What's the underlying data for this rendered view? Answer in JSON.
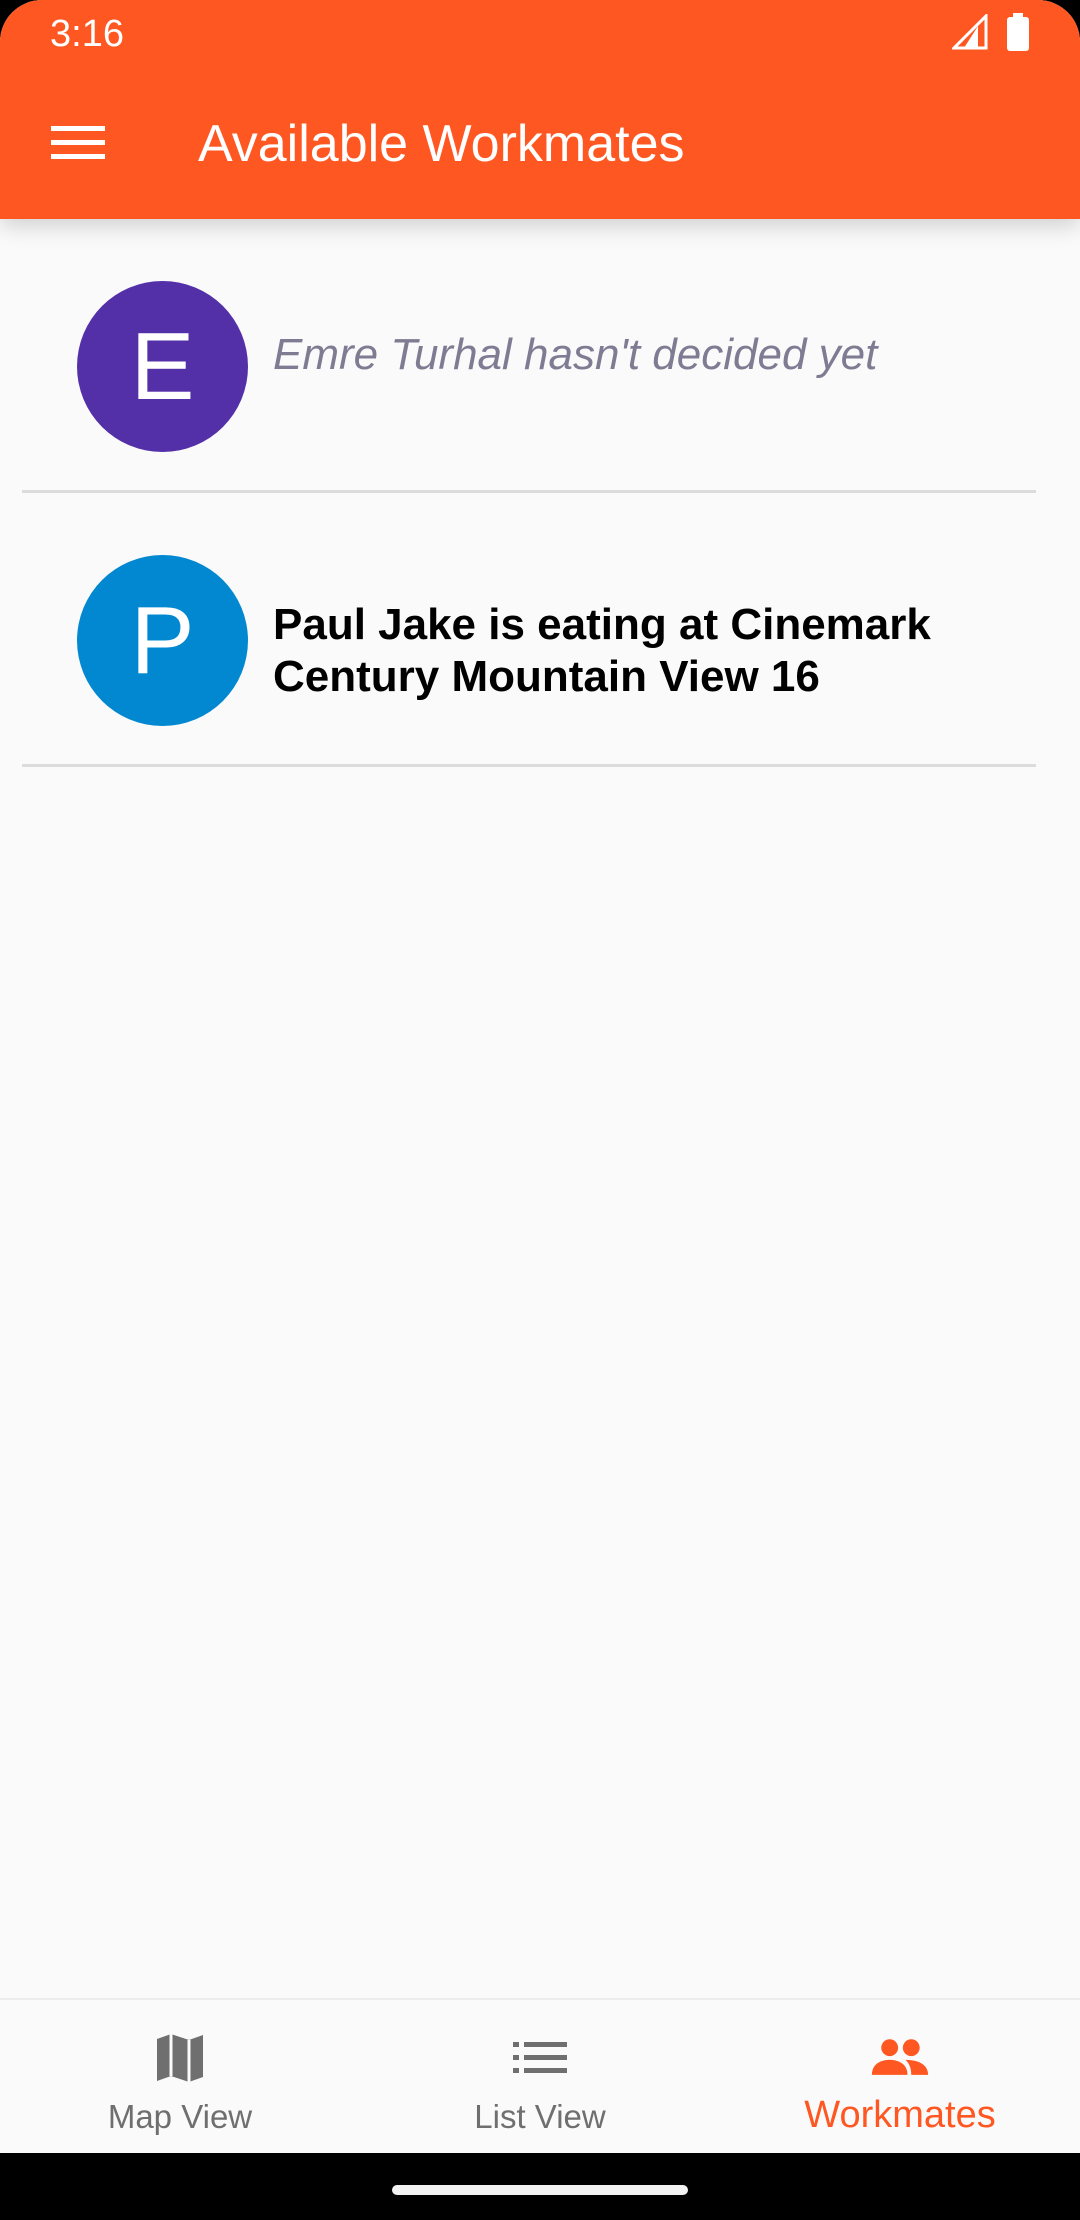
{
  "status_bar": {
    "time": "3:16",
    "icons": [
      "signal-icon",
      "battery-icon"
    ]
  },
  "app_bar": {
    "title": "Available Workmates",
    "menu_icon": "menu-icon",
    "color": "#ff5722"
  },
  "workmates": [
    {
      "initial": "E",
      "avatar_color": "#5430a8",
      "status_text": "Emre Turhal hasn't decided yet",
      "decided": false
    },
    {
      "initial": "P",
      "avatar_color": "#0288d1",
      "status_text": "Paul Jake is eating at Cinemark Century Mountain View 16",
      "decided": true
    }
  ],
  "bottom_nav": {
    "items": [
      {
        "label": "Map View",
        "icon": "map-icon",
        "active": false
      },
      {
        "label": "List View",
        "icon": "list-icon",
        "active": false
      },
      {
        "label": "Workmates",
        "icon": "people-icon",
        "active": true
      }
    ],
    "active_color": "#ff5722",
    "inactive_color": "#6f6f6f"
  }
}
